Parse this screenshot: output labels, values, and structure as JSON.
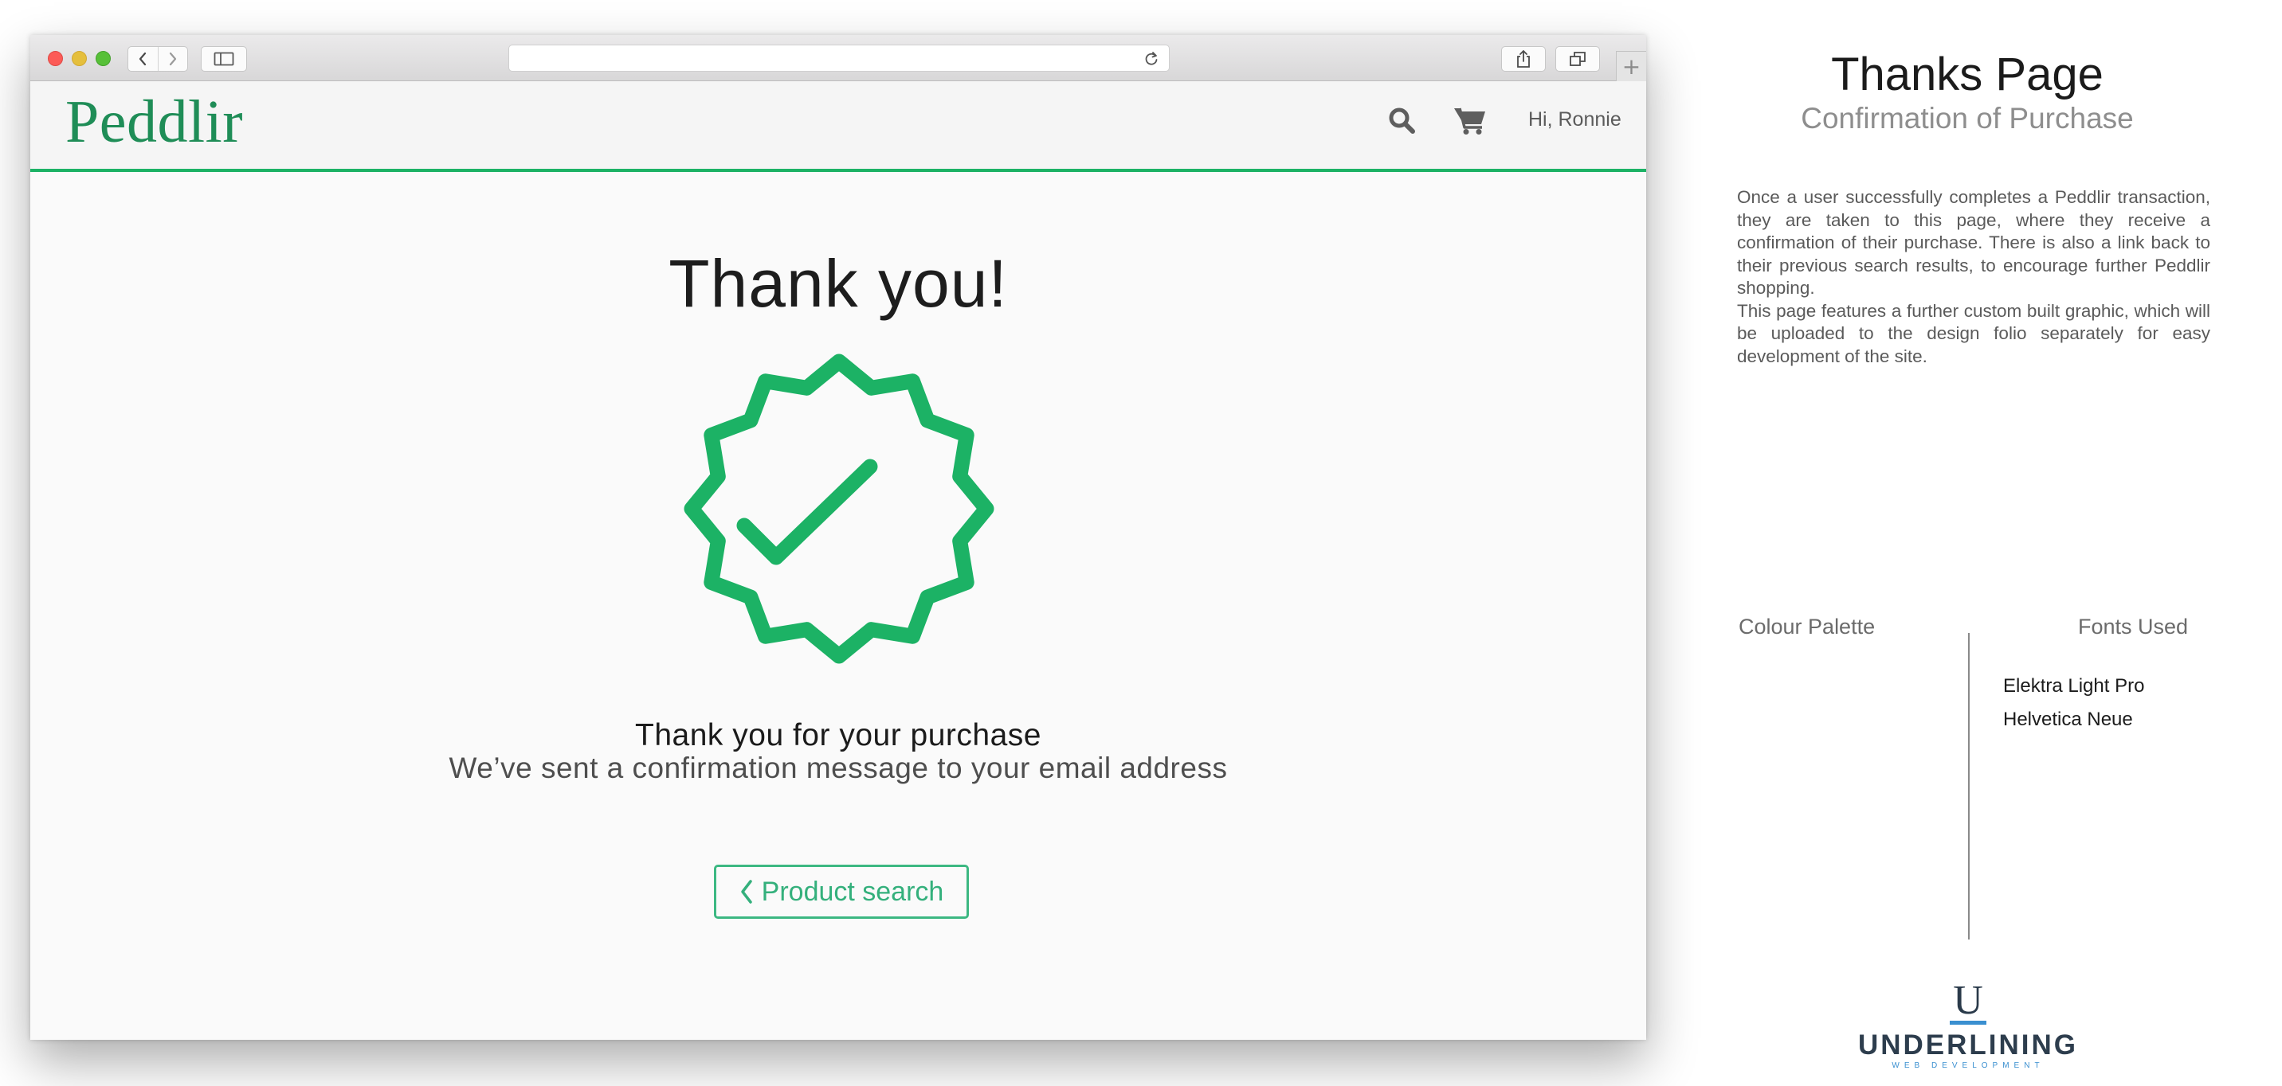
{
  "browser": {
    "icons": {
      "back": "chevron-left-icon",
      "forward": "chevron-right-icon",
      "sidebar": "sidebar-icon",
      "reload": "reload-icon",
      "share": "share-icon",
      "tabs": "tabs-icon",
      "new_tab": "plus-icon"
    },
    "new_tab_glyph": "+"
  },
  "site": {
    "logo": "Peddlir",
    "greeting": "Hi, Ronnie",
    "icons": {
      "search": "search-icon",
      "cart": "cart-icon"
    },
    "accent_color": "#1cb265"
  },
  "main": {
    "heading": "Thank you!",
    "badge_icon": "check-badge-icon",
    "purchase_title": "Thank you for your purchase",
    "purchase_message": "We’ve sent a confirmation message to your email address",
    "back_button_label": "Product search",
    "back_button_icon": "chevron-left-icon",
    "badge_color": "#1cb265",
    "button_color": "#3cb882"
  },
  "annotation": {
    "title": "Thanks Page",
    "subtitle": "Confirmation of Purchase",
    "description_1": "Once a user successfully completes a Peddlir transaction, they are taken to this page, where they receive a confirmation of their purchase.  There is also a link back to their previous search results, to encourage further Peddlir shopping.",
    "description_2": "This page features a further custom built graphic, which will be uploaded to the design folio separately for easy development of the site.",
    "palette_heading": "Colour Palette",
    "fonts_heading": "Fonts Used",
    "fonts": [
      "Elektra Light Pro",
      "Helvetica Neue"
    ]
  },
  "brand": {
    "monogram": "U",
    "name": "UNDERLINING",
    "tagline": "WEB DEVELOPMENT"
  }
}
